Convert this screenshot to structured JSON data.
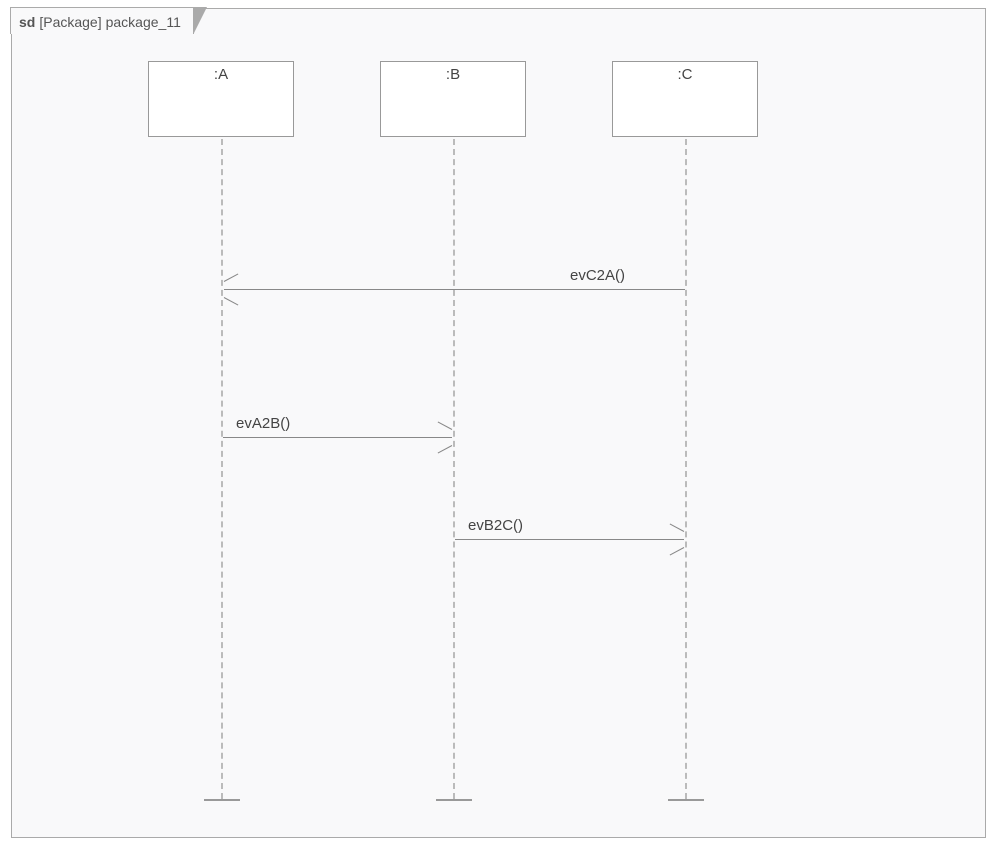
{
  "frame": {
    "prefix": "sd",
    "kind": "[Package]",
    "name": "package_11"
  },
  "lifelines": {
    "A": {
      "label": ":A"
    },
    "B": {
      "label": ":B"
    },
    "C": {
      "label": ":C"
    }
  },
  "messages": {
    "c2a": {
      "label": "evC2A()"
    },
    "a2b": {
      "label": "evA2B()"
    },
    "b2c": {
      "label": "evB2C()"
    }
  }
}
